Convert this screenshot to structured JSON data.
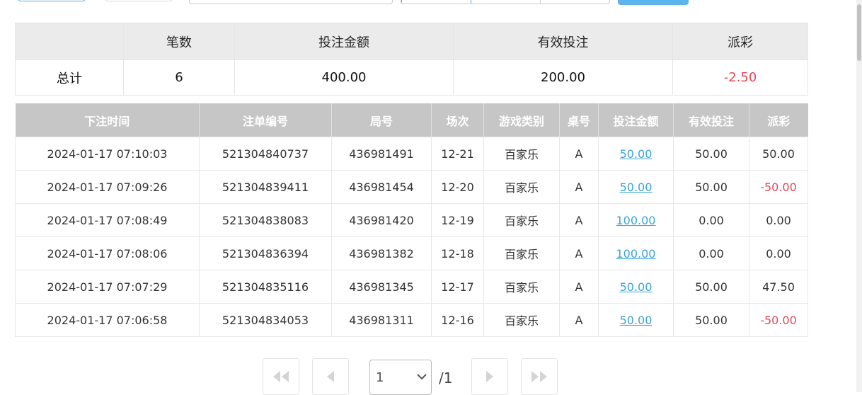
{
  "summary": {
    "headers": [
      "",
      "笔数",
      "投注金额",
      "有效投注",
      "派彩"
    ],
    "row": {
      "label": "总计",
      "count": "6",
      "bet_amount": "400.00",
      "valid_bet": "200.00",
      "payout": "-2.50"
    }
  },
  "detail": {
    "headers": [
      "下注时间",
      "注单编号",
      "局号",
      "场次",
      "游戏类别",
      "桌号",
      "投注金额",
      "有效投注",
      "派彩"
    ],
    "rows": [
      {
        "time": "2024-01-17 07:10:03",
        "bet_id": "521304840737",
        "round_id": "436981491",
        "session": "12-21",
        "game": "百家乐",
        "table": "A",
        "bet_amount": "50.00",
        "valid_bet": "50.00",
        "payout": "50.00",
        "payout_negative": false
      },
      {
        "time": "2024-01-17 07:09:26",
        "bet_id": "521304839411",
        "round_id": "436981454",
        "session": "12-20",
        "game": "百家乐",
        "table": "A",
        "bet_amount": "50.00",
        "valid_bet": "50.00",
        "payout": "-50.00",
        "payout_negative": true
      },
      {
        "time": "2024-01-17 07:08:49",
        "bet_id": "521304838083",
        "round_id": "436981420",
        "session": "12-19",
        "game": "百家乐",
        "table": "A",
        "bet_amount": "100.00",
        "valid_bet": "0.00",
        "payout": "0.00",
        "payout_negative": false
      },
      {
        "time": "2024-01-17 07:08:06",
        "bet_id": "521304836394",
        "round_id": "436981382",
        "session": "12-18",
        "game": "百家乐",
        "table": "A",
        "bet_amount": "100.00",
        "valid_bet": "0.00",
        "payout": "0.00",
        "payout_negative": false
      },
      {
        "time": "2024-01-17 07:07:29",
        "bet_id": "521304835116",
        "round_id": "436981345",
        "session": "12-17",
        "game": "百家乐",
        "table": "A",
        "bet_amount": "50.00",
        "valid_bet": "50.00",
        "payout": "47.50",
        "payout_negative": false
      },
      {
        "time": "2024-01-17 07:06:58",
        "bet_id": "521304834053",
        "round_id": "436981311",
        "session": "12-16",
        "game": "百家乐",
        "table": "A",
        "bet_amount": "50.00",
        "valid_bet": "50.00",
        "payout": "-50.00",
        "payout_negative": true
      }
    ]
  },
  "pagination": {
    "current_page": "1",
    "total_pages": "/1",
    "icons": [
      "first-page-icon",
      "prev-page-icon",
      "next-page-icon",
      "last-page-icon"
    ]
  },
  "colors": {
    "negative": "#e8475b",
    "link": "#3aa6d6",
    "detail_header_bg": "#c6c6c6",
    "summary_header_bg": "#ebebeb",
    "accent": "#5bb4ec"
  }
}
